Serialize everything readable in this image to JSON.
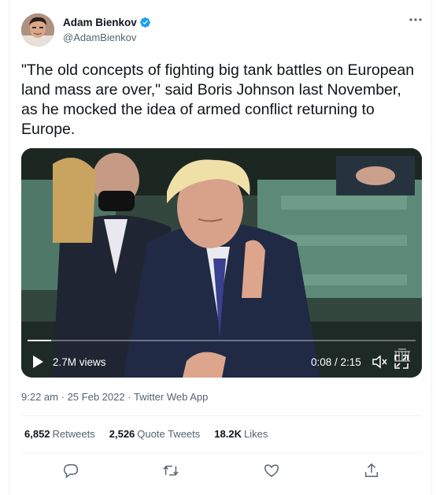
{
  "author": {
    "name": "Adam Bienkov",
    "handle": "@AdamBienkov",
    "verified": true
  },
  "tweet": {
    "text": "\"The old concepts of fighting big tank battles on European land mass are over,\" said Boris Johnson last November, as he mocked the idea of armed conflict returning to Europe."
  },
  "video": {
    "views": "2.7M views",
    "time": "0:08 / 2:15",
    "progress_fraction": 0.06
  },
  "meta": {
    "time": "9:22 am",
    "date": "25 Feb 2022",
    "separator": "·",
    "app": "Twitter Web App"
  },
  "stats": {
    "retweets_count": "6,852",
    "retweets_label": "Retweets",
    "quotes_count": "2,526",
    "quotes_label": "Quote Tweets",
    "likes_count": "18.2K",
    "likes_label": "Likes"
  },
  "icons": {
    "verified": "verified-badge-icon",
    "more": "more-icon",
    "play": "play-icon",
    "mute": "mute-icon",
    "fullscreen": "fullscreen-icon",
    "reply": "reply-icon",
    "retweet": "retweet-icon",
    "like": "like-icon",
    "share": "share-icon"
  },
  "colors": {
    "verified": "#1d9bf0",
    "text": "#0f1419",
    "muted": "#536471"
  }
}
